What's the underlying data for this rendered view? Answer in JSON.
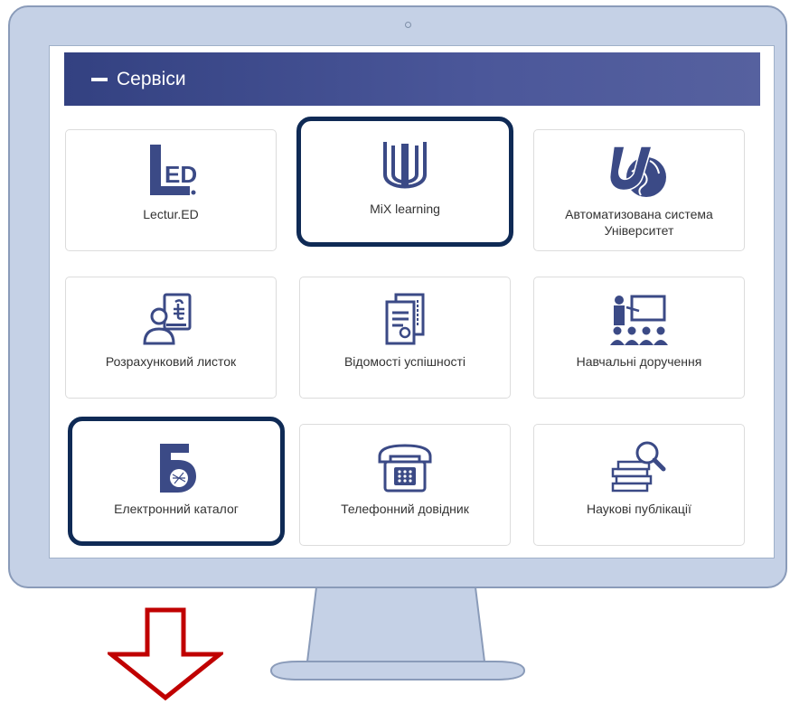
{
  "panel": {
    "title": "Сервіси",
    "colors": {
      "header": "#334181",
      "highlight": "#0f2a55",
      "arrow": "#c00000"
    }
  },
  "tiles": [
    {
      "label": "Lectur.ED",
      "icon": "lectur-ed-logo",
      "highlighted": false
    },
    {
      "label": "MiX learning",
      "icon": "mix-learning-logo",
      "highlighted": true
    },
    {
      "label": "Автоматизована система Університет",
      "icon": "university-globe-logo",
      "highlighted": false
    },
    {
      "label": "Розрахунковий листок",
      "icon": "payslip-icon",
      "highlighted": false
    },
    {
      "label": "Відомості успішності",
      "icon": "grade-sheets-icon",
      "highlighted": false
    },
    {
      "label": "Навчальні доручення",
      "icon": "teaching-assignments-icon",
      "highlighted": false
    },
    {
      "label": "Електронний каталог",
      "icon": "electronic-catalog-logo",
      "highlighted": true
    },
    {
      "label": "Телефонний довідник",
      "icon": "telephone-icon",
      "highlighted": false
    },
    {
      "label": "Наукові публікації",
      "icon": "publications-icon",
      "highlighted": false
    }
  ],
  "lectur_logo_text": "ED"
}
